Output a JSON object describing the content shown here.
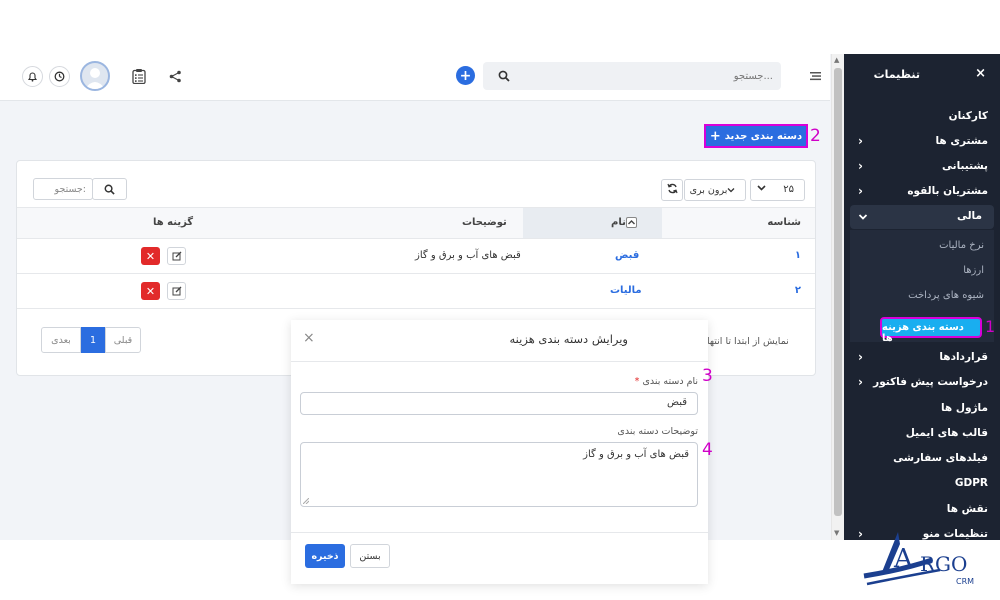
{
  "sidebar": {
    "title": "تنظیمات",
    "close_symbol": "×",
    "items": [
      {
        "label": "کارکنان",
        "chevron": ""
      },
      {
        "label": "مشتری ها",
        "chevron": "›"
      },
      {
        "label": "پشتیبانی",
        "chevron": "›"
      },
      {
        "label": "مشتریان بالقوه",
        "chevron": "›"
      },
      {
        "label": "مالی",
        "chevron": "⌄"
      }
    ],
    "sub_items": [
      "نرخ مالیات",
      "ارزها",
      "شیوه های پرداخت"
    ],
    "highlighted_item": "دسته بندی هزینه ها",
    "items_after": [
      {
        "label": "قراردادها",
        "chevron": "›"
      },
      {
        "label": "درخواست پیش فاکتور",
        "chevron": "›"
      },
      {
        "label": "ماژول ها",
        "chevron": ""
      },
      {
        "label": "قالب های ایمیل",
        "chevron": ""
      },
      {
        "label": "فیلدهای سفارشی",
        "chevron": ""
      },
      {
        "label": "GDPR",
        "chevron": ""
      },
      {
        "label": "نقش ها",
        "chevron": ""
      },
      {
        "label": "تنظیمات منو",
        "chevron": "›"
      }
    ]
  },
  "topbar": {
    "search_placeholder": "جستجو...",
    "menu_icon": "hamburger-icon",
    "add_icon": "plus-circle-icon",
    "icons": [
      "share-icon",
      "clipboard-icon",
      "avatar",
      "clock-icon",
      "bell-icon"
    ]
  },
  "markers": {
    "m1": "1",
    "m2": "2",
    "m3": "3",
    "m4": "4"
  },
  "page": {
    "new_category_button": "دسته بندی جدید",
    "new_category_plus": "+"
  },
  "table": {
    "page_size": "۲۵",
    "export_button": "برون بری",
    "search_placeholder": "جستجو:",
    "columns": {
      "id": "شناسه",
      "name": "نام",
      "description": "توضیحات",
      "options": "گزینه ها"
    },
    "rows": [
      {
        "id": "۱",
        "name": "قبض",
        "description": "قبض های آب و برق و گاز"
      },
      {
        "id": "۲",
        "name": "مالیات",
        "description": ""
      }
    ],
    "info_text": "نمایش از ابتدا تا انتها",
    "pagination": {
      "prev": "قبلی",
      "current": "1",
      "next": "بعدی"
    }
  },
  "modal": {
    "title": "ویرایش دسته بندی هزینه",
    "close_symbol": "×",
    "name_label": "نام دسته بندی",
    "required_mark": "*",
    "name_value": "قبض",
    "description_label": "توضیحات دسته بندی",
    "description_value": "قبض های آب و برق و گاز",
    "save_button": "ذخیره",
    "close_button": "بستن"
  },
  "logo": {
    "brand_main": "RGO",
    "brand_letter": "A",
    "brand_sub": "CRM"
  },
  "colors": {
    "accent": "#2b6de0",
    "sidebar_bg": "#1c2331",
    "highlight": "#19aef0",
    "marker": "#d000c8",
    "danger": "#e22a2a"
  }
}
